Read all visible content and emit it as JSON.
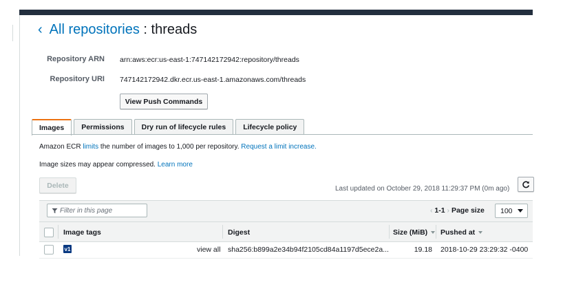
{
  "header": {
    "back_glyph": "‹",
    "crumb": "All repositories",
    "separator": " : ",
    "repo_name": "threads"
  },
  "details": {
    "arn_label": "Repository ARN",
    "arn_value": "arn:aws:ecr:us-east-1:747142172942:repository/threads",
    "uri_label": "Repository URI",
    "uri_value": "747142172942.dkr.ecr.us-east-1.amazonaws.com/threads",
    "push_button": "View Push Commands"
  },
  "tabs": [
    {
      "label": "Images",
      "active": true
    },
    {
      "label": "Permissions",
      "active": false
    },
    {
      "label": "Dry run of lifecycle rules",
      "active": false
    },
    {
      "label": "Lifecycle policy",
      "active": false
    }
  ],
  "notes": {
    "limit_prefix": "Amazon ECR ",
    "limit_link": "limits",
    "limit_mid": " the number of images to 1,000 per repository. ",
    "limit_request_link": "Request a limit increase.",
    "size_prefix": "Image sizes may appear compressed. ",
    "size_link": "Learn more"
  },
  "actions": {
    "delete_button": "Delete",
    "last_updated": "Last updated on October 29, 2018 11:29:37 PM (0m ago)",
    "refresh_icon": "refresh-icon"
  },
  "toolbar": {
    "filter_placeholder": "Filter in this page",
    "pager_prev": "‹",
    "pager_range": "1-1",
    "pager_next": "›",
    "page_size_label": "Page size",
    "page_size_value": "100"
  },
  "table": {
    "columns": {
      "tags": "Image tags",
      "digest": "Digest",
      "size": "Size (MiB)",
      "pushed": "Pushed at"
    },
    "rows": [
      {
        "tag": "v1",
        "view_all": "view all",
        "digest": "sha256:b899a2e34b94f2105cd84a1197d5ece2a...",
        "size": "19.18",
        "pushed": "2018-10-29 23:29:32 -0400"
      }
    ]
  },
  "colors": {
    "link": "#0073bb",
    "topbar": "#232f3e",
    "active_tab_accent": "#ec7211",
    "tag_badge": "#0a3a82"
  }
}
